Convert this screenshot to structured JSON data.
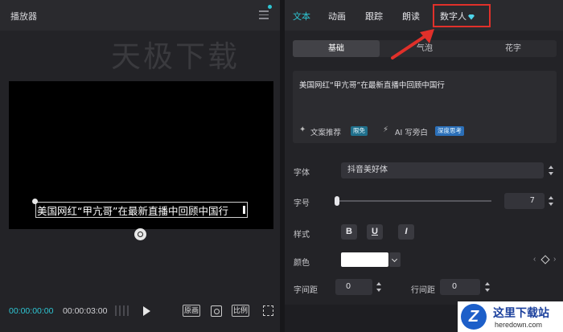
{
  "player": {
    "title": "播放器",
    "watermark": "天极下载",
    "subtitle": "美国网红“甲亢哥”在最新直播中回顾中国行",
    "time_current": "00:00:00:00",
    "time_total": "00:00:03:00",
    "buttons": {
      "original": "原画",
      "ratio": "比例"
    }
  },
  "inspector": {
    "tabs": [
      "文本",
      "动画",
      "跟踪",
      "朗读",
      "数字人"
    ],
    "active_tab": "文本",
    "sub_tabs": [
      "基础",
      "气泡",
      "花字"
    ],
    "active_sub_tab": "基础",
    "text_content": "美国网红“甲亢哥”在最新直播中回顾中国行",
    "actions": {
      "recommend": "文案推荐",
      "recommend_badge": "限免",
      "ai_narration": "AI 写旁白",
      "ai_badge": "深度思考"
    },
    "font": {
      "label": "字体",
      "value": "抖音美好体"
    },
    "size": {
      "label": "字号",
      "value": "7"
    },
    "style": {
      "label": "样式",
      "bold": "B",
      "underline": "U",
      "italic": "I"
    },
    "color": {
      "label": "颜色",
      "value": "#ffffff"
    },
    "letter_spacing": {
      "label": "字间距",
      "value": "0"
    },
    "line_spacing": {
      "label": "行间距",
      "value": "0"
    }
  },
  "logo": {
    "name": "这里下载站",
    "url_text": "heredown.com"
  },
  "colors": {
    "accent": "#2ec5d3",
    "highlight": "#e0302a"
  }
}
